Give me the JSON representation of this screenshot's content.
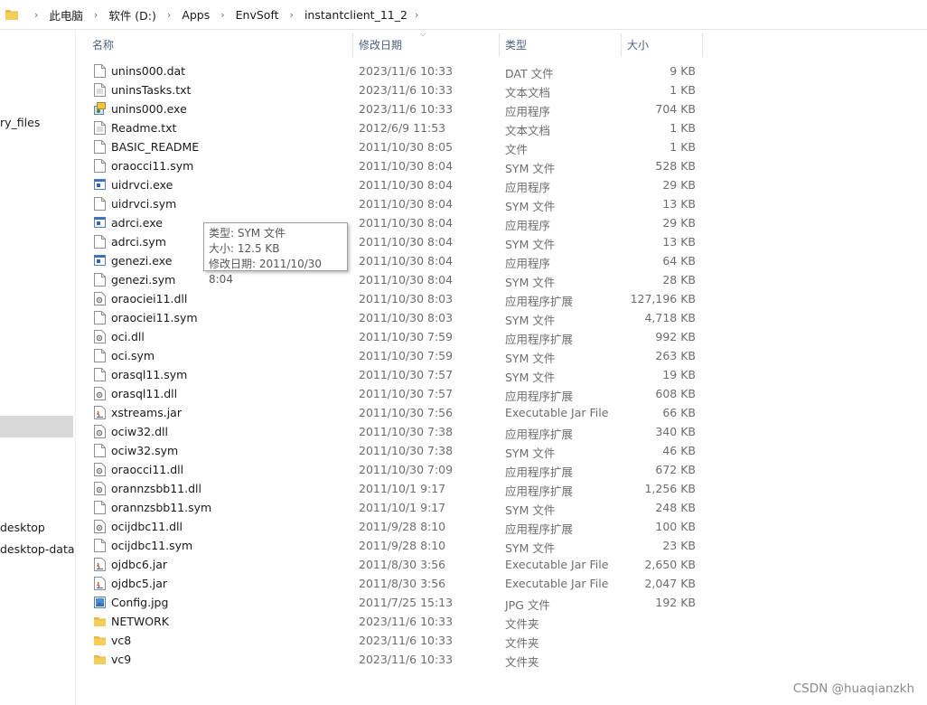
{
  "breadcrumb": [
    "此电脑",
    "软件 (D:)",
    "Apps",
    "EnvSoft",
    "instantclient_11_2"
  ],
  "nav_items": [
    "ry_files",
    "desktop",
    "desktop-data"
  ],
  "columns": {
    "name": "名称",
    "date": "修改日期",
    "type": "类型",
    "size": "大小"
  },
  "files": [
    {
      "name": "unins000.dat",
      "date": "2023/11/6 10:33",
      "type": "DAT 文件",
      "size": "9 KB",
      "icon": "file-icon"
    },
    {
      "name": "uninsTasks.txt",
      "date": "2023/11/6 10:33",
      "type": "文本文档",
      "size": "1 KB",
      "icon": "text-file-icon"
    },
    {
      "name": "unins000.exe",
      "date": "2023/11/6 10:33",
      "type": "应用程序",
      "size": "704 KB",
      "icon": "installer-icon"
    },
    {
      "name": "Readme.txt",
      "date": "2012/6/9 11:53",
      "type": "文本文档",
      "size": "1 KB",
      "icon": "text-file-icon"
    },
    {
      "name": "BASIC_README",
      "date": "2011/10/30 8:05",
      "type": "文件",
      "size": "1 KB",
      "icon": "file-icon"
    },
    {
      "name": "oraocci11.sym",
      "date": "2011/10/30 8:04",
      "type": "SYM 文件",
      "size": "528 KB",
      "icon": "file-icon"
    },
    {
      "name": "uidrvci.exe",
      "date": "2011/10/30 8:04",
      "type": "应用程序",
      "size": "29 KB",
      "icon": "exe-icon"
    },
    {
      "name": "uidrvci.sym",
      "date": "2011/10/30 8:04",
      "type": "SYM 文件",
      "size": "13 KB",
      "icon": "file-icon"
    },
    {
      "name": "adrci.exe",
      "date": "2011/10/30 8:04",
      "type": "应用程序",
      "size": "29 KB",
      "icon": "exe-icon"
    },
    {
      "name": "adrci.sym",
      "date": "2011/10/30 8:04",
      "type": "SYM 文件",
      "size": "13 KB",
      "icon": "file-icon"
    },
    {
      "name": "genezi.exe",
      "date": "2011/10/30 8:04",
      "type": "应用程序",
      "size": "64 KB",
      "icon": "exe-icon"
    },
    {
      "name": "genezi.sym",
      "date": "2011/10/30 8:04",
      "type": "SYM 文件",
      "size": "28 KB",
      "icon": "file-icon"
    },
    {
      "name": "oraociei11.dll",
      "date": "2011/10/30 8:03",
      "type": "应用程序扩展",
      "size": "127,196 KB",
      "icon": "dll-icon"
    },
    {
      "name": "oraociei11.sym",
      "date": "2011/10/30 8:03",
      "type": "SYM 文件",
      "size": "4,718 KB",
      "icon": "file-icon"
    },
    {
      "name": "oci.dll",
      "date": "2011/10/30 7:59",
      "type": "应用程序扩展",
      "size": "992 KB",
      "icon": "dll-icon"
    },
    {
      "name": "oci.sym",
      "date": "2011/10/30 7:59",
      "type": "SYM 文件",
      "size": "263 KB",
      "icon": "file-icon"
    },
    {
      "name": "orasql11.sym",
      "date": "2011/10/30 7:57",
      "type": "SYM 文件",
      "size": "19 KB",
      "icon": "file-icon"
    },
    {
      "name": "orasql11.dll",
      "date": "2011/10/30 7:57",
      "type": "应用程序扩展",
      "size": "608 KB",
      "icon": "dll-icon"
    },
    {
      "name": "xstreams.jar",
      "date": "2011/10/30 7:56",
      "type": "Executable Jar File",
      "size": "66 KB",
      "icon": "jar-icon"
    },
    {
      "name": "ociw32.dll",
      "date": "2011/10/30 7:38",
      "type": "应用程序扩展",
      "size": "340 KB",
      "icon": "dll-icon"
    },
    {
      "name": "ociw32.sym",
      "date": "2011/10/30 7:38",
      "type": "SYM 文件",
      "size": "46 KB",
      "icon": "file-icon"
    },
    {
      "name": "oraocci11.dll",
      "date": "2011/10/30 7:09",
      "type": "应用程序扩展",
      "size": "672 KB",
      "icon": "dll-icon"
    },
    {
      "name": "orannzsbb11.dll",
      "date": "2011/10/1 9:17",
      "type": "应用程序扩展",
      "size": "1,256 KB",
      "icon": "dll-icon"
    },
    {
      "name": "orannzsbb11.sym",
      "date": "2011/10/1 9:17",
      "type": "SYM 文件",
      "size": "248 KB",
      "icon": "file-icon"
    },
    {
      "name": "ocijdbc11.dll",
      "date": "2011/9/28 8:10",
      "type": "应用程序扩展",
      "size": "100 KB",
      "icon": "dll-icon"
    },
    {
      "name": "ocijdbc11.sym",
      "date": "2011/9/28 8:10",
      "type": "SYM 文件",
      "size": "23 KB",
      "icon": "file-icon"
    },
    {
      "name": "ojdbc6.jar",
      "date": "2011/8/30 3:56",
      "type": "Executable Jar File",
      "size": "2,650 KB",
      "icon": "jar-icon"
    },
    {
      "name": "ojdbc5.jar",
      "date": "2011/8/30 3:56",
      "type": "Executable Jar File",
      "size": "2,047 KB",
      "icon": "jar-icon"
    },
    {
      "name": "Config.jpg",
      "date": "2011/7/25 15:13",
      "type": "JPG 文件",
      "size": "192 KB",
      "icon": "image-icon"
    },
    {
      "name": "NETWORK",
      "date": "2023/11/6 10:33",
      "type": "文件夹",
      "size": "",
      "icon": "folder-icon"
    },
    {
      "name": "vc8",
      "date": "2023/11/6 10:33",
      "type": "文件夹",
      "size": "",
      "icon": "folder-icon"
    },
    {
      "name": "vc9",
      "date": "2023/11/6 10:33",
      "type": "文件夹",
      "size": "",
      "icon": "folder-icon"
    }
  ],
  "tooltip": {
    "type_line": "类型: SYM 文件",
    "size_line": "大小: 12.5 KB",
    "date_line": "修改日期: 2011/10/30 8:04"
  },
  "watermark": "CSDN @huaqianzkh",
  "colors": {
    "folder": "#f2c94c",
    "header_text": "#4d6082",
    "selected_nav": "#d9d9d9"
  }
}
